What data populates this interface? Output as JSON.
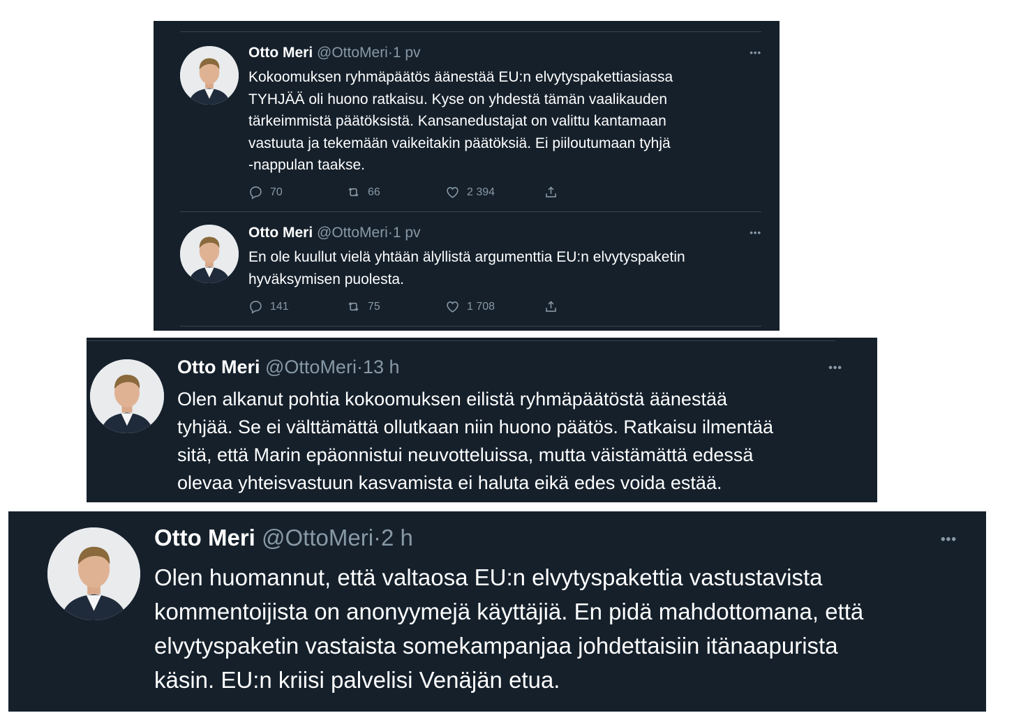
{
  "tweets": [
    {
      "name": "Otto Meri",
      "handle": "@OttoMeri",
      "time": "1 pv",
      "lines": [
        "Kokoomuksen ryhmäpäätös äänestää EU:n elvytyspakettiasiassa",
        "TYHJÄÄ oli huono ratkaisu. Kyse on yhdestä tämän vaalikauden",
        "tärkeimmistä päätöksistä. Kansanedustajat on valittu kantamaan",
        "vastuuta ja tekemään vaikeitakin päätöksiä. Ei piiloutumaan tyhjä",
        "-nappulan taakse."
      ],
      "replies": "70",
      "retweets": "66",
      "likes": "2 394",
      "reply_icon": "reply-icon",
      "retweet_icon": "retweet-icon",
      "like_icon": "heart-icon",
      "share_icon": "share-icon",
      "more_icon": "more-icon"
    },
    {
      "name": "Otto Meri",
      "handle": "@OttoMeri",
      "time": "1 pv",
      "lines": [
        "En ole kuullut vielä yhtään älyllistä argumenttia EU:n elvytyspaketin",
        "hyväksymisen puolesta."
      ],
      "replies": "141",
      "retweets": "75",
      "likes": "1 708",
      "reply_icon": "reply-icon",
      "retweet_icon": "retweet-icon",
      "like_icon": "heart-icon",
      "share_icon": "share-icon",
      "more_icon": "more-icon"
    },
    {
      "name": "Otto Meri",
      "handle": "@OttoMeri",
      "time": "13 h",
      "lines": [
        "Olen alkanut pohtia kokoomuksen eilistä ryhmäpäätöstä äänestää",
        "tyhjää. Se ei välttämättä ollutkaan niin huono päätös. Ratkaisu ilmentää",
        "sitä, että Marin epäonnistui neuvotteluissa, mutta väistämättä edessä",
        "olevaa yhteisvastuun kasvamista ei haluta eikä edes voida estää."
      ],
      "more_icon": "more-icon"
    },
    {
      "name": "Otto Meri",
      "handle": "@OttoMeri",
      "time": "2 h",
      "lines": [
        "Olen huomannut, että valtaosa EU:n elvytyspakettia vastustavista",
        "kommentoijista on anonyymejä käyttäjiä. En pidä mahdottomana, että",
        "elvytyspaketin vastaista somekampanjaa johdettaisiin itänaapurista",
        "käsin. EU:n kriisi palvelisi Venäjän etua."
      ],
      "more_icon": "more-icon"
    }
  ],
  "dot_separator": "·",
  "more_glyph": "•••",
  "colors": {
    "background": "#15202b",
    "text": "#ffffff",
    "secondary": "#8899a6",
    "divider": "#38444d",
    "page": "#ffffff"
  }
}
